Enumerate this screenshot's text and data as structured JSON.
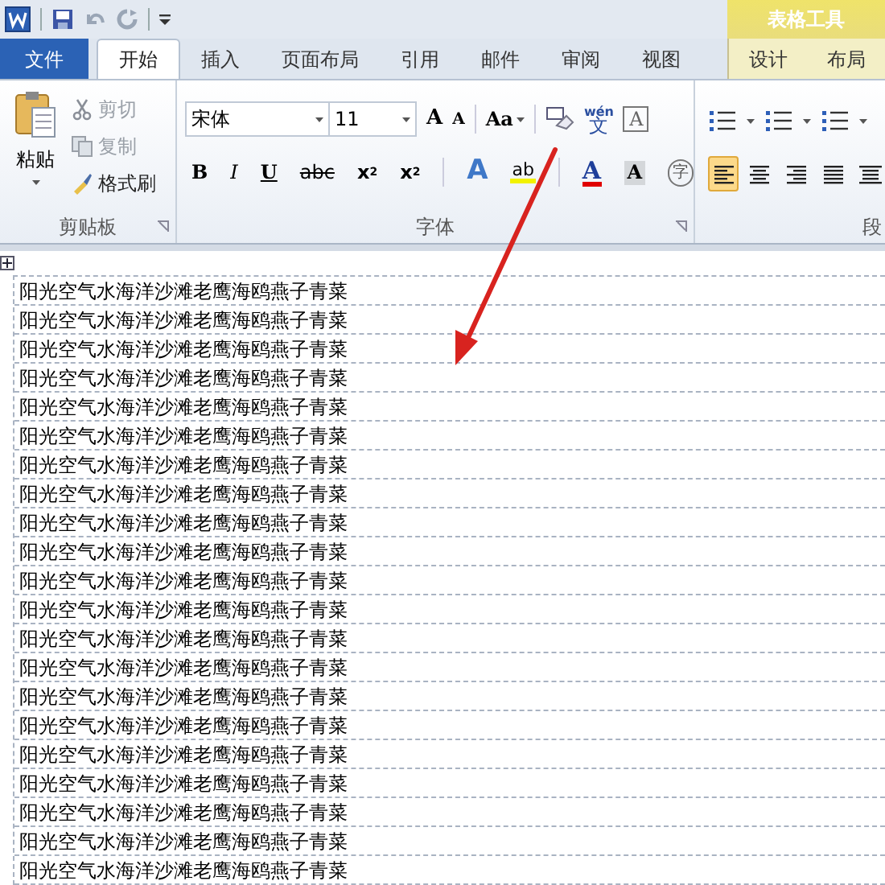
{
  "contextual_tab_group": {
    "title": "表格工具"
  },
  "tabs": [
    {
      "label": "文件",
      "kind": "file",
      "selected": false
    },
    {
      "label": "开始",
      "kind": "tab",
      "selected": true
    },
    {
      "label": "插入",
      "kind": "tab",
      "selected": false
    },
    {
      "label": "页面布局",
      "kind": "tab",
      "selected": false
    },
    {
      "label": "引用",
      "kind": "tab",
      "selected": false
    },
    {
      "label": "邮件",
      "kind": "tab",
      "selected": false
    },
    {
      "label": "审阅",
      "kind": "tab",
      "selected": false
    },
    {
      "label": "视图",
      "kind": "tab",
      "selected": false
    },
    {
      "label": "设计",
      "kind": "context",
      "selected": false
    },
    {
      "label": "布局",
      "kind": "context",
      "selected": false
    }
  ],
  "clipboard": {
    "paste": "粘贴",
    "items": [
      {
        "label": "剪切",
        "disabled": true
      },
      {
        "label": "复制",
        "disabled": true
      },
      {
        "label": "格式刷",
        "disabled": false
      }
    ],
    "group_label": "剪贴板"
  },
  "font": {
    "font_name": "宋体",
    "font_size": "11",
    "row_1": [
      "A",
      "A",
      "Aa"
    ],
    "row_1_extra": [
      "wén",
      "文",
      "A"
    ],
    "row_2": [
      {
        "kind": "bold",
        "label": "B"
      },
      {
        "kind": "italic",
        "label": "I"
      },
      {
        "kind": "underline",
        "label": "U"
      },
      {
        "kind": "strike",
        "label": "abc"
      },
      {
        "kind": "sub",
        "label": "x",
        "script": "2"
      },
      {
        "kind": "sup",
        "label": "x",
        "script": "2"
      }
    ],
    "effects": {
      "text_effect": "A",
      "highlight": "ab",
      "font_color": "A",
      "shading": "A",
      "enclose": "字"
    },
    "group_label": "字体"
  },
  "paragraph": {
    "alignment": [
      {
        "selected": true
      },
      {
        "selected": false
      },
      {
        "selected": false
      },
      {
        "selected": false
      },
      {
        "selected": false
      }
    ],
    "group_label": "段"
  },
  "table": {
    "rows": [
      "阳光空气水海洋沙滩老鹰海鸥燕子青菜",
      "阳光空气水海洋沙滩老鹰海鸥燕子青菜",
      "阳光空气水海洋沙滩老鹰海鸥燕子青菜",
      "阳光空气水海洋沙滩老鹰海鸥燕子青菜",
      "阳光空气水海洋沙滩老鹰海鸥燕子青菜",
      "阳光空气水海洋沙滩老鹰海鸥燕子青菜",
      "阳光空气水海洋沙滩老鹰海鸥燕子青菜",
      "阳光空气水海洋沙滩老鹰海鸥燕子青菜",
      "阳光空气水海洋沙滩老鹰海鸥燕子青菜",
      "阳光空气水海洋沙滩老鹰海鸥燕子青菜",
      "阳光空气水海洋沙滩老鹰海鸥燕子青菜",
      "阳光空气水海洋沙滩老鹰海鸥燕子青菜",
      "阳光空气水海洋沙滩老鹰海鸥燕子青菜",
      "阳光空气水海洋沙滩老鹰海鸥燕子青菜",
      "阳光空气水海洋沙滩老鹰海鸥燕子青菜",
      "阳光空气水海洋沙滩老鹰海鸥燕子青菜",
      "阳光空气水海洋沙滩老鹰海鸥燕子青菜",
      "阳光空气水海洋沙滩老鹰海鸥燕子青菜",
      "阳光空气水海洋沙滩老鹰海鸥燕子青菜",
      "阳光空气水海洋沙滩老鹰海鸥燕子青菜",
      "阳光空气水海洋沙滩老鹰海鸥燕子青菜"
    ]
  }
}
